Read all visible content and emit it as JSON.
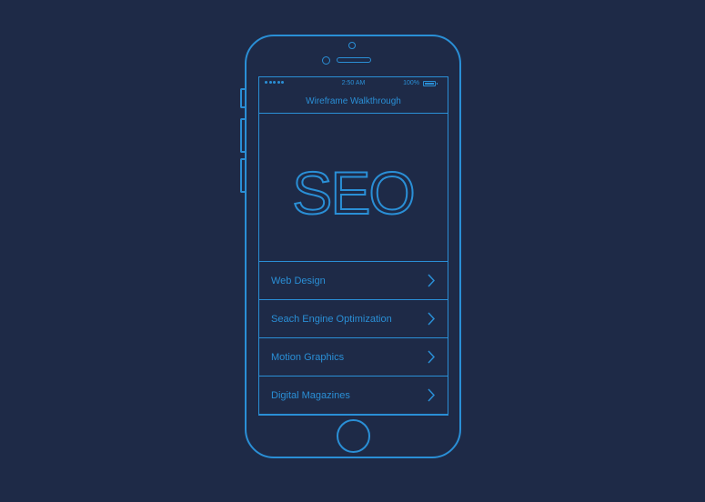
{
  "status_bar": {
    "time": "2:50 AM",
    "battery_percent": "100%",
    "signal_dots": 5
  },
  "nav": {
    "title": "Wireframe Walkthrough"
  },
  "hero": {
    "text": "SEO"
  },
  "menu": {
    "items": [
      {
        "label": "Web Design",
        "icon": "chevron-right-icon"
      },
      {
        "label": "Seach Engine Optimization",
        "icon": "chevron-right-icon"
      },
      {
        "label": "Motion Graphics",
        "icon": "chevron-right-icon"
      },
      {
        "label": "Digital Magazines",
        "icon": "chevron-right-icon"
      }
    ]
  },
  "colors": {
    "background": "#1e2a47",
    "line": "#2a8fd6"
  }
}
